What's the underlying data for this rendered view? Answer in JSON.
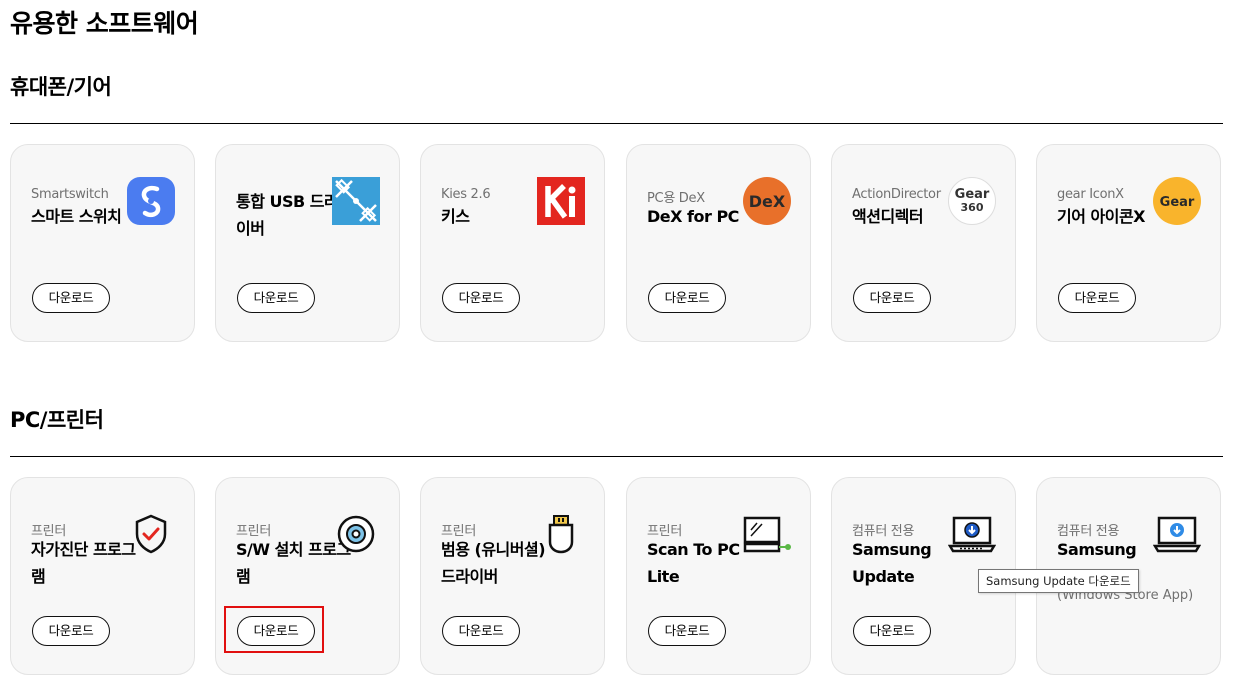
{
  "page": {
    "title": "유용한 소프트웨어"
  },
  "sections": [
    {
      "title": "휴대폰/기어",
      "cards": [
        {
          "sub": "Smartswitch",
          "name": "스마트 스위치",
          "icon": "smart-switch-icon",
          "button": "다운로드"
        },
        {
          "sub": "",
          "name": "통합 USB 드라이버",
          "icon": "usb-driver-icon",
          "button": "다운로드"
        },
        {
          "sub": "Kies 2.6",
          "name": "키스",
          "icon": "kies-icon",
          "button": "다운로드"
        },
        {
          "sub": "PC용 DeX",
          "name": "DeX for PC",
          "icon": "dex-icon",
          "icon_text": "DeX",
          "button": "다운로드"
        },
        {
          "sub": "ActionDirector",
          "name": "액션디렉터",
          "icon": "gear-360-icon",
          "icon_text": "Gear",
          "icon_text2": "360",
          "button": "다운로드"
        },
        {
          "sub": "gear IconX",
          "name": "기어 아이콘X",
          "icon": "gear-iconx-icon",
          "icon_text": "Gear",
          "button": "다운로드"
        }
      ]
    },
    {
      "title": "PC/프린터",
      "cards": [
        {
          "sub": "프린터",
          "name": "자가진단 프로그램",
          "icon": "shield-check-icon",
          "button": "다운로드"
        },
        {
          "sub": "프린터",
          "name": "S/W 설치 프로그램",
          "icon": "disc-icon",
          "button": "다운로드"
        },
        {
          "sub": "프린터",
          "name": "범용 (유니버셜) 드라이버",
          "icon": "usb-plug-icon",
          "button": "다운로드"
        },
        {
          "sub": "프린터",
          "name": "Scan To PC Lite",
          "icon": "scanner-laptop-icon",
          "button": "다운로드"
        },
        {
          "sub": "컴퓨터 전용",
          "name": "Samsung Update",
          "icon": "laptop-download-icon",
          "button": "다운로드"
        },
        {
          "sub": "컴퓨터 전용",
          "name": "Samsung",
          "note": "(Windows Store App)",
          "icon": "laptop-download-icon",
          "button": ""
        }
      ]
    }
  ],
  "tooltip": "Samsung Update 다운로드",
  "colors": {
    "dex": "#e8702a",
    "gear": "#f9b42c",
    "kies": "#e3261f",
    "usb": "#3a9fd8",
    "switch": "#4b7cf0",
    "highlight": "#e10f0f"
  }
}
